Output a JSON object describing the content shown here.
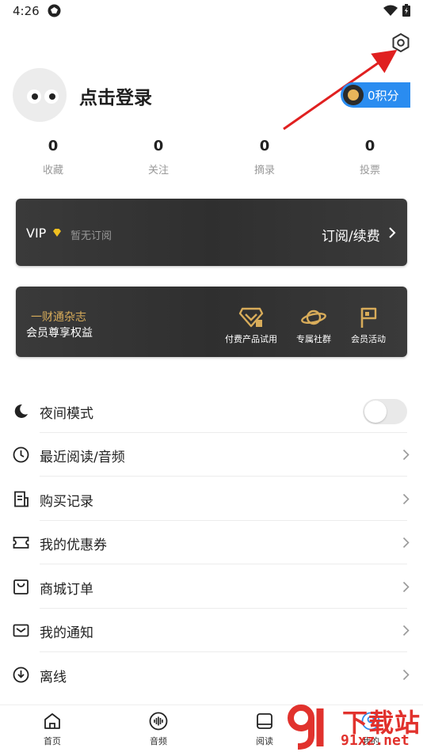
{
  "status_bar": {
    "time": "4:26"
  },
  "profile": {
    "login_text": "点击登录",
    "points_label": "0积分"
  },
  "stats": [
    {
      "value": "0",
      "label": "收藏"
    },
    {
      "value": "0",
      "label": "关注"
    },
    {
      "value": "0",
      "label": "摘录"
    },
    {
      "value": "0",
      "label": "投票"
    }
  ],
  "vip_card": {
    "label": "VIP",
    "status": "暂无订阅",
    "action": "订阅/续费"
  },
  "member_card": {
    "title": "一财通杂志",
    "subtitle": "会员尊享权益",
    "benefits": [
      {
        "label": "付费产品试用",
        "icon": "gift-icon"
      },
      {
        "label": "专属社群",
        "icon": "planet-icon"
      },
      {
        "label": "会员活动",
        "icon": "flag-icon"
      }
    ]
  },
  "menu": [
    {
      "label": "夜间模式",
      "icon": "moon-icon",
      "type": "toggle",
      "on": false
    },
    {
      "label": "最近阅读/音频",
      "icon": "clock-icon",
      "type": "link"
    },
    {
      "label": "购买记录",
      "icon": "receipt-icon",
      "type": "link"
    },
    {
      "label": "我的优惠券",
      "icon": "coupon-icon",
      "type": "link"
    },
    {
      "label": "商城订单",
      "icon": "bag-icon",
      "type": "link"
    },
    {
      "label": "我的通知",
      "icon": "mail-icon",
      "type": "link"
    },
    {
      "label": "离线",
      "icon": "download-icon",
      "type": "link"
    }
  ],
  "tab_bar": [
    {
      "label": "首页",
      "icon": "home-icon"
    },
    {
      "label": "音频",
      "icon": "audio-icon"
    },
    {
      "label": "阅读",
      "icon": "book-icon"
    },
    {
      "label": "我的",
      "icon": "user-icon"
    }
  ],
  "watermark": {
    "title": "下载站",
    "url": "91xz.net"
  },
  "colors": {
    "accent_blue": "#2a8cf0",
    "gold": "#d8ac5a",
    "card_dark": "#333333",
    "annotation_red": "#e02020"
  }
}
